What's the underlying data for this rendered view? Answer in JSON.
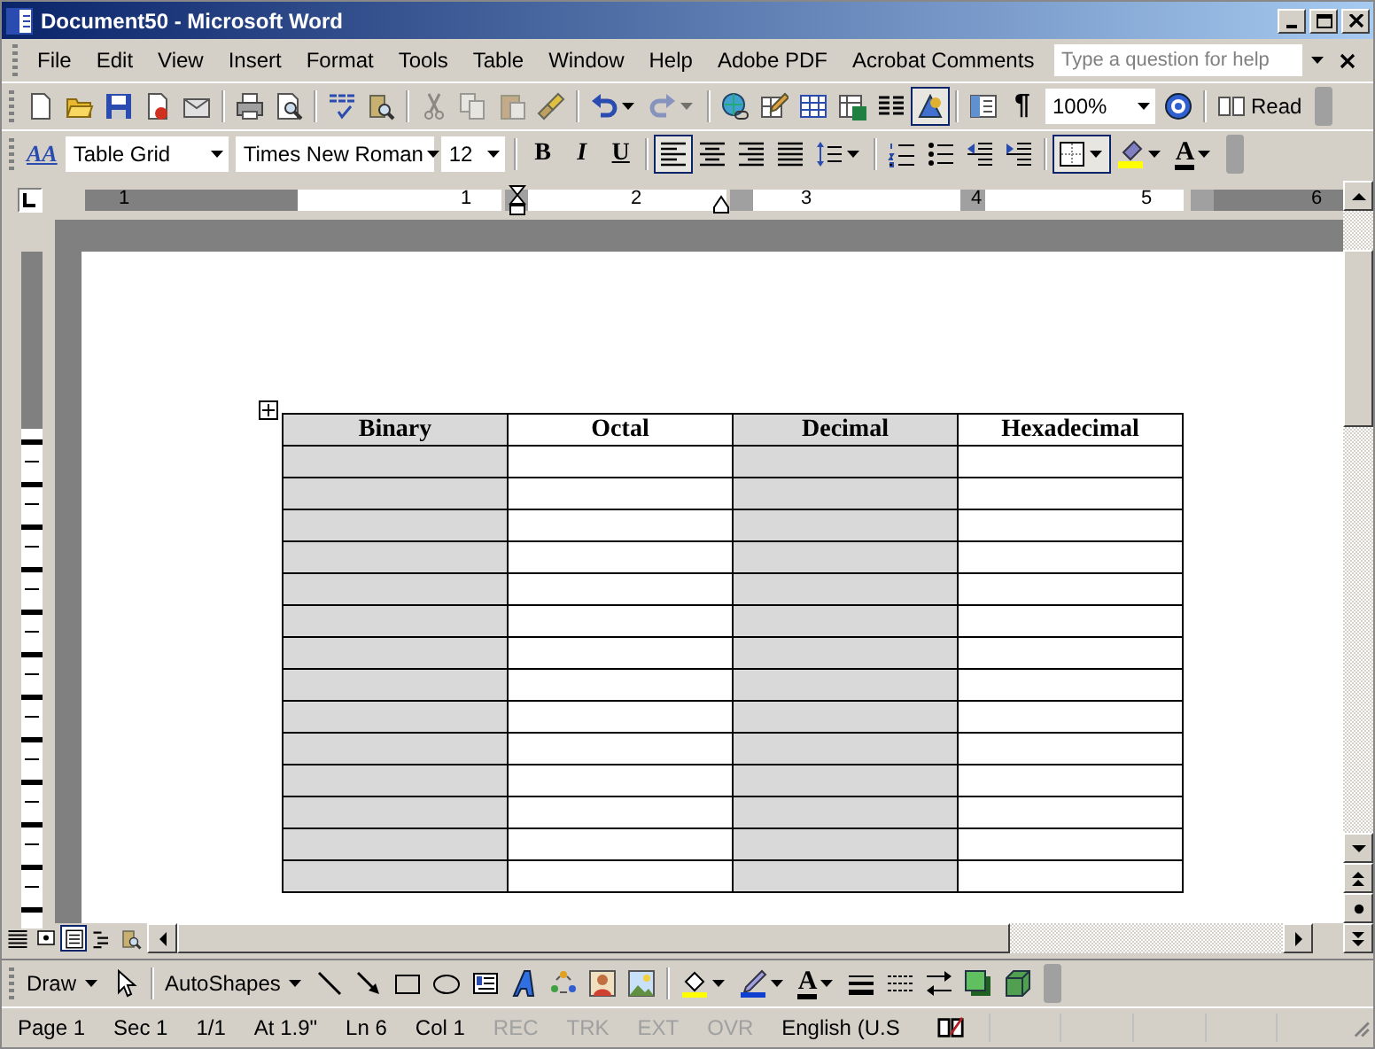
{
  "window": {
    "title": "Document50 - Microsoft Word"
  },
  "menu_bar": {
    "items": [
      {
        "label": "File"
      },
      {
        "label": "Edit"
      },
      {
        "label": "View"
      },
      {
        "label": "Insert"
      },
      {
        "label": "Format"
      },
      {
        "label": "Tools"
      },
      {
        "label": "Table"
      },
      {
        "label": "Window"
      },
      {
        "label": "Help"
      },
      {
        "label": "Adobe PDF"
      },
      {
        "label": "Acrobat Comments"
      }
    ],
    "help_box": {
      "placeholder": "Type a question for help"
    }
  },
  "standard_toolbar": [
    {
      "kind": "icon",
      "selected": false,
      "disabled": false
    },
    {
      "kind": "icon",
      "selected": false,
      "disabled": false
    },
    {
      "kind": "icon",
      "selected": false,
      "disabled": false
    },
    {
      "kind": "icon",
      "selected": false,
      "disabled": false
    },
    {
      "kind": "icon",
      "selected": false,
      "disabled": false
    },
    {
      "kind": "sep"
    },
    {
      "kind": "icon",
      "selected": false,
      "disabled": false
    },
    {
      "kind": "icon",
      "selected": false,
      "disabled": false
    },
    {
      "kind": "sep"
    },
    {
      "kind": "icon",
      "selected": false,
      "disabled": false
    },
    {
      "kind": "icon",
      "selected": false,
      "disabled": false
    },
    {
      "kind": "sep"
    },
    {
      "kind": "icon",
      "selected": false,
      "disabled": true
    },
    {
      "kind": "icon",
      "selected": false,
      "disabled": true
    },
    {
      "kind": "icon",
      "selected": false,
      "disabled": true
    },
    {
      "kind": "icon",
      "selected": false,
      "disabled": false
    },
    {
      "kind": "sep"
    },
    {
      "kind": "icon",
      "selected": false,
      "disabled": false,
      "dropdown": true
    },
    {
      "kind": "icon",
      "selected": false,
      "disabled": true,
      "dropdown": true
    },
    {
      "kind": "sep"
    },
    {
      "kind": "icon",
      "selected": false,
      "disabled": false
    },
    {
      "kind": "icon",
      "selected": false,
      "disabled": false
    },
    {
      "kind": "icon",
      "selected": false,
      "disabled": false
    },
    {
      "kind": "icon",
      "selected": false,
      "disabled": false
    },
    {
      "kind": "icon",
      "selected": false,
      "disabled": false
    },
    {
      "kind": "icon",
      "selected": true,
      "disabled": false
    },
    {
      "kind": "sep"
    },
    {
      "kind": "icon",
      "selected": false,
      "disabled": false
    },
    {
      "kind": "pilcrow",
      "label": "¶"
    },
    {
      "kind": "combo",
      "value": "100%"
    },
    {
      "kind": "icon",
      "selected": false,
      "disabled": false
    },
    {
      "kind": "sep"
    },
    {
      "kind": "labeled",
      "label": "Read"
    }
  ],
  "formatting_toolbar": [
    {
      "kind": "styles",
      "label": "AA"
    },
    {
      "kind": "combo",
      "value": "Table Grid"
    },
    {
      "kind": "combo",
      "value": "Times New Roman"
    },
    {
      "kind": "combo",
      "value": "12"
    },
    {
      "kind": "sep"
    },
    {
      "kind": "bold",
      "label": "B"
    },
    {
      "kind": "italic",
      "label": "I"
    },
    {
      "kind": "underline",
      "label": "U"
    },
    {
      "kind": "sep"
    },
    {
      "kind": "icon",
      "selected": true,
      "disabled": false
    },
    {
      "kind": "icon",
      "selected": false,
      "disabled": false
    },
    {
      "kind": "icon",
      "selected": false,
      "disabled": false
    },
    {
      "kind": "icon",
      "selected": false,
      "disabled": false
    },
    {
      "kind": "icon",
      "selected": false,
      "disabled": false,
      "dropdown": true
    },
    {
      "kind": "sep"
    },
    {
      "kind": "icon",
      "selected": false,
      "disabled": false
    },
    {
      "kind": "icon",
      "selected": false,
      "disabled": false
    },
    {
      "kind": "icon",
      "selected": false,
      "disabled": false
    },
    {
      "kind": "icon",
      "selected": false,
      "disabled": false
    },
    {
      "kind": "sep"
    },
    {
      "kind": "icon",
      "selected": true,
      "disabled": false,
      "dropdown": true
    },
    {
      "kind": "icon",
      "selected": false,
      "disabled": false,
      "dropdown": true
    },
    {
      "kind": "color",
      "label": "A",
      "dropdown": true
    }
  ],
  "ruler": {
    "labels": [
      "1",
      "1",
      "2",
      "3",
      "4",
      "5",
      "6"
    ]
  },
  "table": {
    "columns": [
      {
        "label": "Binary",
        "shaded": true
      },
      {
        "label": "Octal",
        "shaded": false
      },
      {
        "label": "Decimal",
        "shaded": true
      },
      {
        "label": "Hexadecimal",
        "shaded": false
      }
    ],
    "rows": [
      {
        "kind": "empty"
      },
      {
        "kind": "empty"
      },
      {
        "kind": "empty"
      },
      {
        "kind": "empty"
      },
      {
        "kind": "empty"
      },
      {
        "kind": "empty"
      },
      {
        "kind": "empty"
      },
      {
        "kind": "empty"
      },
      {
        "kind": "empty"
      },
      {
        "kind": "empty"
      },
      {
        "kind": "empty"
      },
      {
        "kind": "empty"
      },
      {
        "kind": "empty"
      },
      {
        "kind": "empty"
      }
    ]
  },
  "view_buttons": [
    {
      "selected": false
    },
    {
      "selected": false
    },
    {
      "selected": true
    },
    {
      "selected": false
    },
    {
      "selected": false
    }
  ],
  "drawing_toolbar": [
    {
      "kind": "menu",
      "label": "Draw"
    },
    {
      "kind": "icon",
      "selected": false,
      "disabled": false
    },
    {
      "kind": "sep"
    },
    {
      "kind": "menu",
      "label": "AutoShapes"
    },
    {
      "kind": "icon",
      "selected": false,
      "disabled": false
    },
    {
      "kind": "icon",
      "selected": false,
      "disabled": false
    },
    {
      "kind": "icon",
      "selected": false,
      "disabled": false
    },
    {
      "kind": "icon",
      "selected": false,
      "disabled": false
    },
    {
      "kind": "icon",
      "selected": false,
      "disabled": false
    },
    {
      "kind": "icon",
      "selected": false,
      "disabled": false
    },
    {
      "kind": "icon",
      "selected": false,
      "disabled": false
    },
    {
      "kind": "icon",
      "selected": false,
      "disabled": false
    },
    {
      "kind": "icon",
      "selected": false,
      "disabled": false
    },
    {
      "kind": "sep"
    },
    {
      "kind": "icon",
      "selected": false,
      "disabled": false,
      "dropdown": true
    },
    {
      "kind": "icon",
      "selected": false,
      "disabled": false,
      "dropdown": true
    },
    {
      "kind": "color",
      "label": "A",
      "dropdown": true
    },
    {
      "kind": "icon",
      "selected": false,
      "disabled": false
    },
    {
      "kind": "icon",
      "selected": false,
      "disabled": false
    },
    {
      "kind": "icon",
      "selected": false,
      "disabled": false
    },
    {
      "kind": "icon",
      "selected": false,
      "disabled": false
    },
    {
      "kind": "icon",
      "selected": false,
      "disabled": false
    }
  ],
  "status_bar": {
    "fields": [
      {
        "text": "Page 1",
        "disabled": false
      },
      {
        "text": "Sec 1",
        "disabled": false
      },
      {
        "text": "1/1",
        "disabled": false
      },
      {
        "text": "At 1.9\"",
        "disabled": false
      },
      {
        "text": "Ln 6",
        "disabled": false
      },
      {
        "text": "Col 1",
        "disabled": false
      },
      {
        "text": "REC",
        "disabled": true
      },
      {
        "text": "TRK",
        "disabled": true
      },
      {
        "text": "EXT",
        "disabled": true
      },
      {
        "text": "OVR",
        "disabled": true
      },
      {
        "text": "English (U.S",
        "disabled": false
      }
    ]
  }
}
